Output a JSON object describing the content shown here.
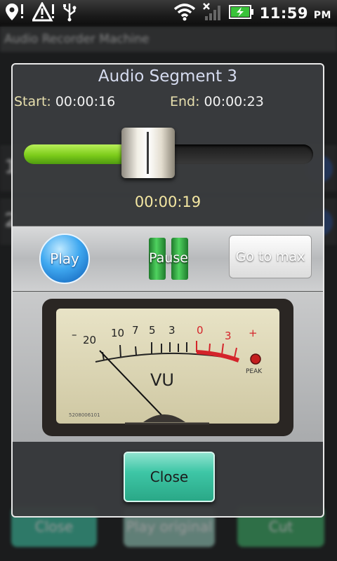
{
  "status_bar": {
    "time": "11:59",
    "ampm": "PM"
  },
  "background_app": {
    "title": "Audio Recorder Machine",
    "row_numbers": [
      "1",
      "2"
    ],
    "buttons": [
      "Close",
      "Play original",
      "Cut"
    ]
  },
  "dialog": {
    "title": "Audio Segment 3",
    "start_label": "Start:",
    "start_value": "00:00:16",
    "end_label": "End:",
    "end_value": "00:00:23",
    "current_time": "00:00:19",
    "slider_position": 0.43,
    "play_label": "Play",
    "pause_label": "Pause",
    "go_to_max_label": "Go to max",
    "close_label": "Close"
  },
  "vu_meter": {
    "scale_black": [
      "20",
      "10",
      "7",
      "5",
      "3"
    ],
    "scale_red": [
      "0",
      "3"
    ],
    "minus_sign": "–",
    "plus_sign": "+",
    "vu_label": "VU",
    "peak_label": "PEAK",
    "serial": "5208006101"
  },
  "colors": {
    "accent_green": "#7ccc1a",
    "title_color": "#d6dcf0",
    "label_color": "#e7dfae",
    "current_time_color": "#f4e7a2",
    "close_button": "#3ec6a6",
    "meter_red": "#d4242a"
  }
}
